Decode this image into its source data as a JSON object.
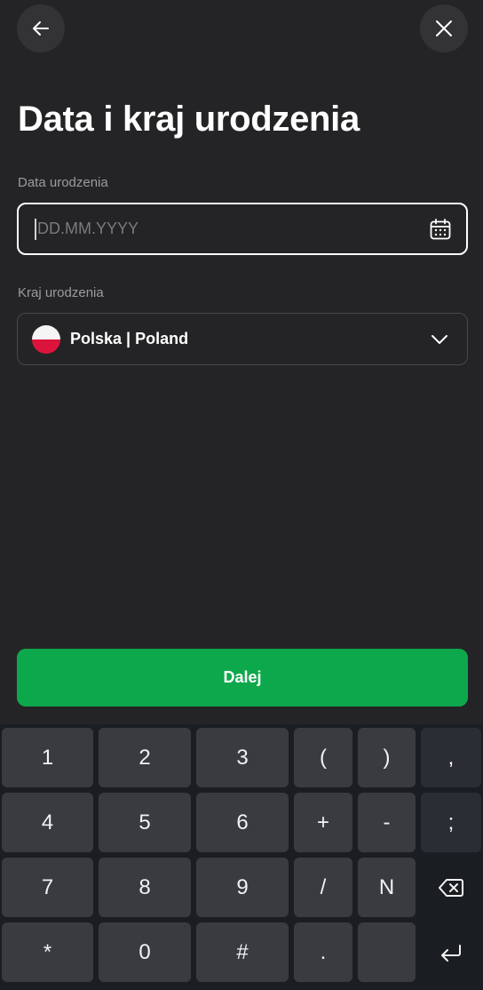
{
  "header": {
    "title": "Data i kraj urodzenia"
  },
  "birth_date": {
    "label": "Data urodzenia",
    "value": "",
    "placeholder": "DD.MM.YYYY"
  },
  "birth_country": {
    "label": "Kraj urodzenia",
    "value": "Polska | Poland",
    "flag_colors": [
      "#f5f5f5",
      "#dc143c"
    ]
  },
  "actions": {
    "next_label": "Dalej",
    "next_color": "#0ea84c"
  },
  "icons": {
    "back": "arrow-left-icon",
    "close": "close-icon",
    "calendar": "calendar-icon",
    "dropdown": "chevron-down-icon",
    "backspace": "backspace-icon",
    "enter": "enter-icon"
  },
  "keyboard": {
    "row1": [
      "1",
      "2",
      "3",
      "(",
      ")",
      ","
    ],
    "row2": [
      "4",
      "5",
      "6",
      "+",
      "-",
      ";"
    ],
    "row3": [
      "7",
      "8",
      "9",
      "/",
      "N"
    ],
    "row4": [
      "*",
      "0",
      "#",
      ".",
      ""
    ]
  }
}
